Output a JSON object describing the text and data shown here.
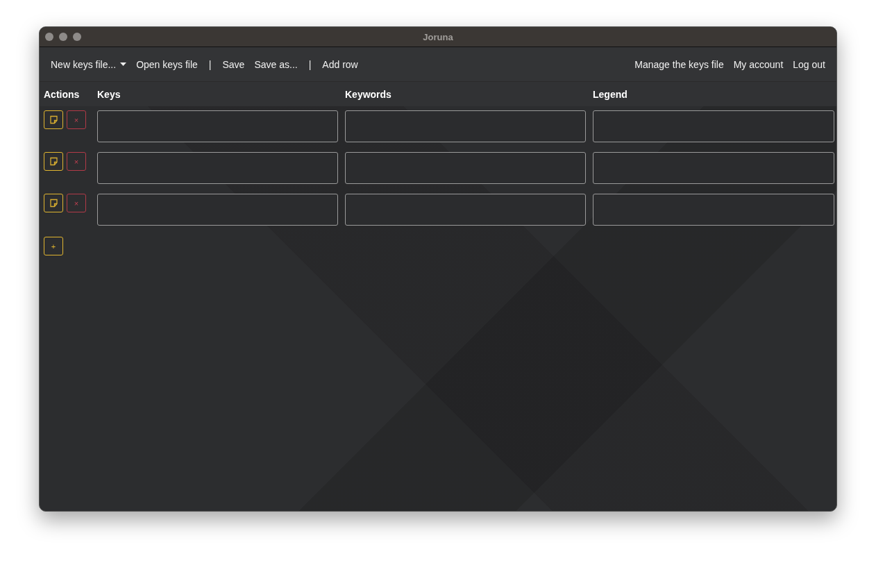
{
  "window": {
    "title": "Joruna"
  },
  "toolbar": {
    "left": [
      {
        "kind": "dropdown",
        "label": "New keys file..."
      },
      {
        "kind": "link",
        "label": "Open keys file"
      },
      {
        "kind": "separator",
        "label": "|"
      },
      {
        "kind": "link",
        "label": "Save"
      },
      {
        "kind": "link",
        "label": "Save as..."
      },
      {
        "kind": "separator",
        "label": "|"
      },
      {
        "kind": "link",
        "label": "Add row"
      }
    ],
    "right": [
      {
        "kind": "link",
        "label": "Manage the keys file"
      },
      {
        "kind": "link",
        "label": "My account"
      },
      {
        "kind": "link",
        "label": "Log out"
      }
    ]
  },
  "table": {
    "columns": [
      "Actions",
      "Keys",
      "Keywords",
      "Legend"
    ],
    "rows": [
      {
        "delete": "×"
      },
      {
        "delete": "×"
      },
      {
        "delete": "×"
      }
    ],
    "add_button": "+"
  }
}
